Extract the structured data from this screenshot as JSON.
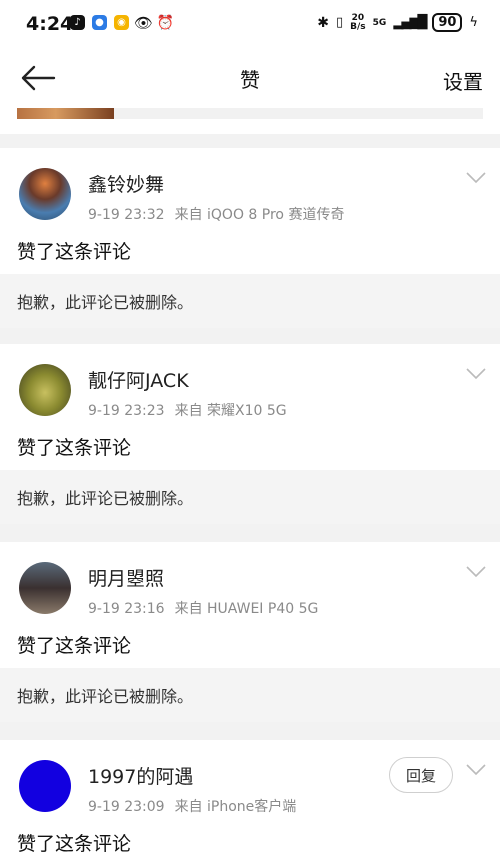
{
  "status_bar": {
    "time": "4:24",
    "net_speed_value": "20",
    "net_speed_unit": "B/s",
    "network": "5G",
    "battery": "90"
  },
  "nav": {
    "title": "赞",
    "settings_label": "设置"
  },
  "comments": [
    {
      "username": "鑫铃妙舞",
      "time": "9-19 23:32",
      "source": "来自 iQOO 8 Pro 赛道传奇",
      "action": "赞了这条评论",
      "quote": "抱歉，此评论已被删除。"
    },
    {
      "username": "靓仔阿JACK",
      "time": "9-19 23:23",
      "source": "来自 荣耀X10 5G",
      "action": "赞了这条评论",
      "quote": "抱歉，此评论已被删除。"
    },
    {
      "username": "明月曌照",
      "time": "9-19 23:16",
      "source": "来自 HUAWEI P40 5G",
      "action": "赞了这条评论",
      "quote": "抱歉，此评论已被删除。"
    },
    {
      "username": "1997的阿遇",
      "time": "9-19 23:09",
      "source": "来自 iPhone客户端",
      "action": "赞了这条评论",
      "reply_label": "回复"
    }
  ]
}
